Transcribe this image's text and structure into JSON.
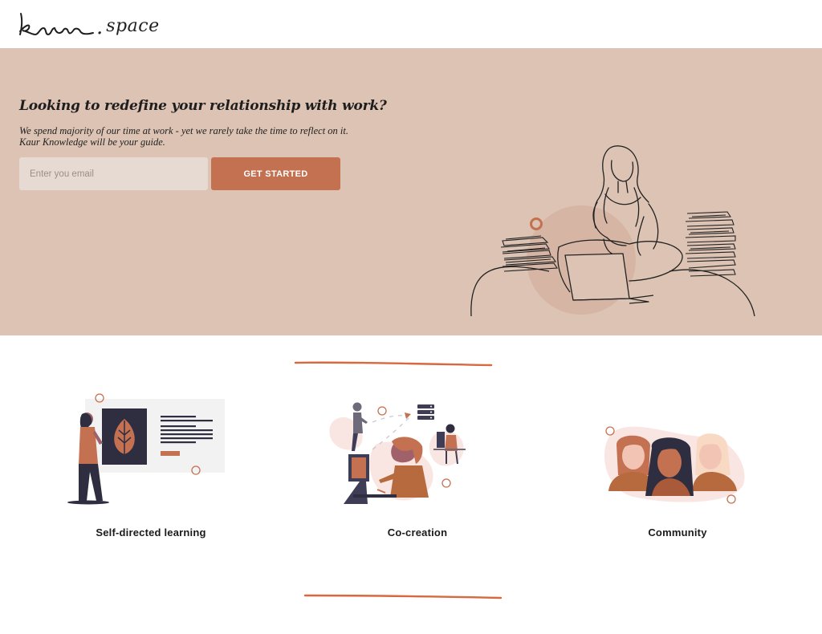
{
  "header": {
    "logo_script": "kaur",
    "logo_dot": ".",
    "logo_space": "space"
  },
  "hero": {
    "title": "Looking to redefine your relationship with work?",
    "subtitle": "We spend majority of our time at work - yet we rarely take the time to reflect on it. Kaur Knowledge will be your guide.",
    "email_placeholder": "Enter you email",
    "cta_label": "GET STARTED"
  },
  "features": [
    {
      "label": "Self-directed learning",
      "icon": "learning-illustration"
    },
    {
      "label": "Co-creation",
      "icon": "co-creation-illustration"
    },
    {
      "label": "Community",
      "icon": "community-illustration"
    }
  ],
  "colors": {
    "hero_bg": "#dcc3b3",
    "accent": "#c47152",
    "input_bg": "#e7dad2",
    "divider": "#d9673f",
    "navy": "#2f2e41"
  }
}
